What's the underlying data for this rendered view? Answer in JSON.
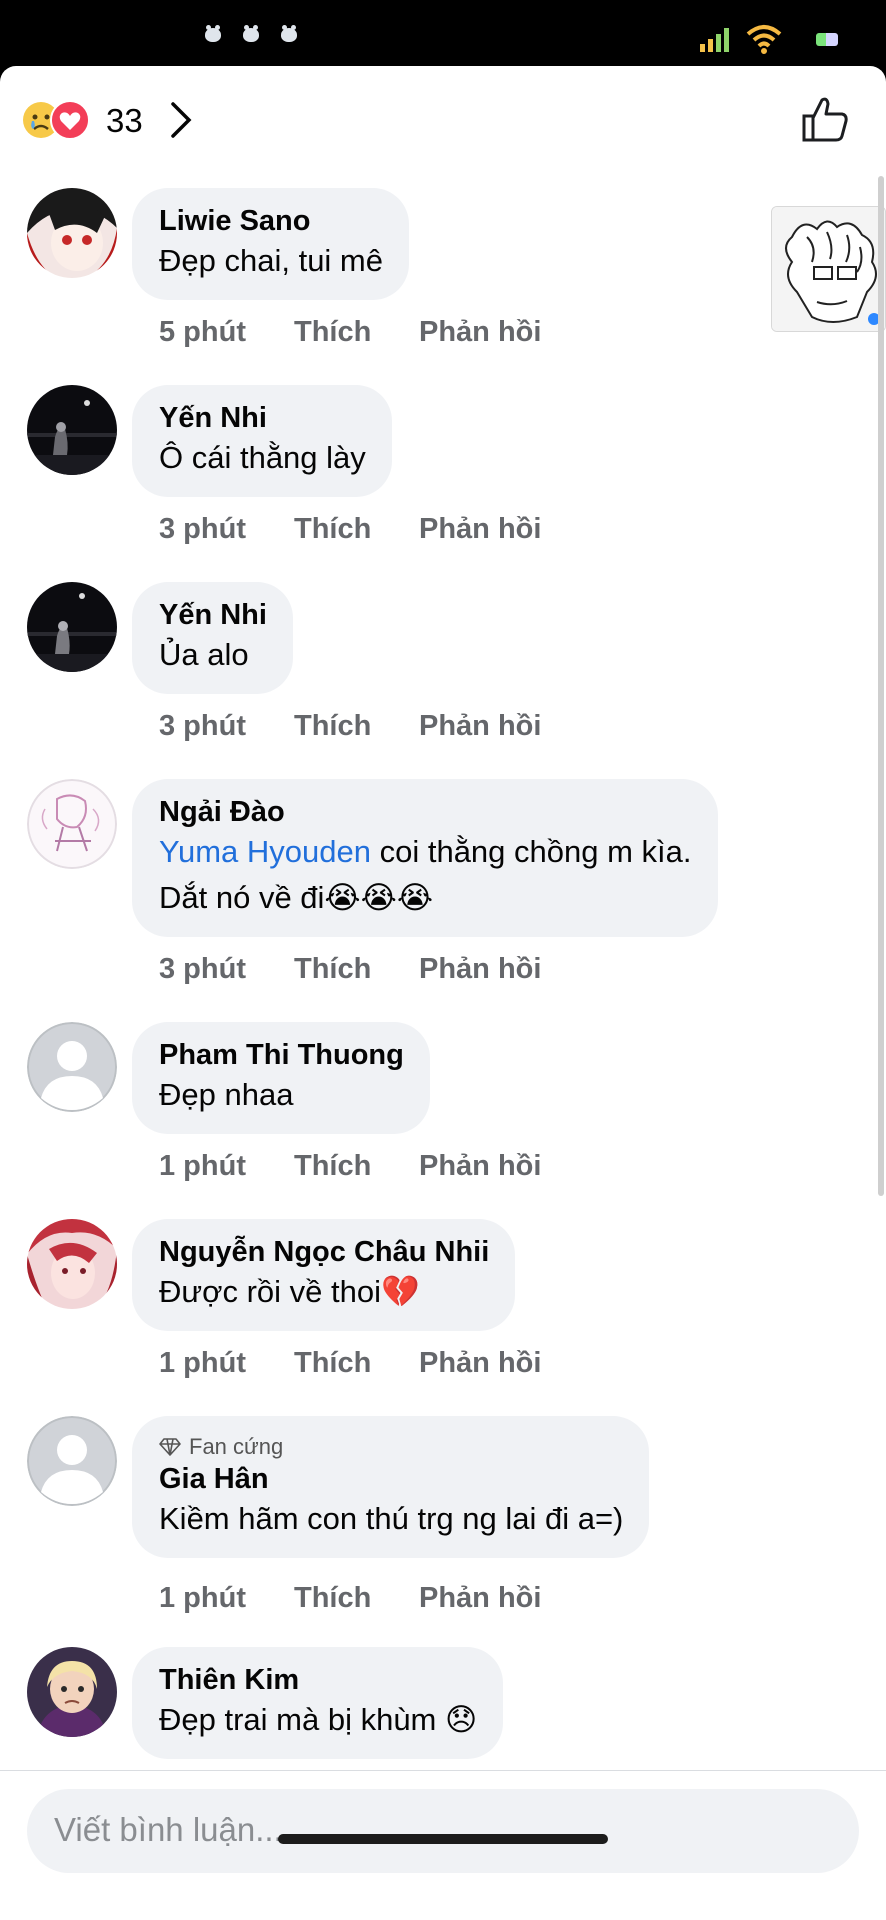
{
  "reactions": {
    "count": "33",
    "icons": [
      "sad-face-icon",
      "heart-icon"
    ]
  },
  "comments": [
    {
      "author": "Liwie Sano",
      "lines": [
        "Đẹp chai, tui mê"
      ],
      "time": "5 phút",
      "like": "Thích",
      "reply": "Phản hồi",
      "avatar": "anime-girl"
    },
    {
      "author": "Yến Nhi",
      "lines": [
        "Ô cái thằng lày"
      ],
      "time": "3 phút",
      "like": "Thích",
      "reply": "Phản hồi",
      "avatar": "night-photo"
    },
    {
      "author": "Yến Nhi",
      "lines": [
        "Ủa alo"
      ],
      "time": "3 phút",
      "like": "Thích",
      "reply": "Phản hồi",
      "avatar": "night-photo"
    },
    {
      "author": "Ngải Đào",
      "mention": "Yuma Hyouden",
      "line1_rest": " coi thằng chồng m kìa.",
      "line2": "Dắt nó về đi😭😭😭",
      "time": "3 phút",
      "like": "Thích",
      "reply": "Phản hồi",
      "avatar": "sketch"
    },
    {
      "author": "Pham Thi Thuong",
      "lines": [
        "Đẹp nhaa"
      ],
      "time": "1 phút",
      "like": "Thích",
      "reply": "Phản hồi",
      "avatar": "default"
    },
    {
      "author": "Nguyễn Ngọc Châu Nhii",
      "lines": [
        "Được rồi về thoi💔"
      ],
      "time": "1 phút",
      "like": "Thích",
      "reply": "Phản hồi",
      "avatar": "red-hair"
    },
    {
      "badge": "Fan cứng",
      "author": "Gia Hân",
      "lines": [
        "Kiềm hãm con thú trg ng lai đi a=)"
      ],
      "time": "1 phút",
      "like": "Thích",
      "reply": "Phản hồi",
      "avatar": "default"
    },
    {
      "author": "Thiên Kim",
      "lines": [
        "Đẹp trai mà bị khùm 😞"
      ],
      "avatar": "child-photo"
    }
  ],
  "composer": {
    "placeholder": "Viết bình luận..."
  }
}
